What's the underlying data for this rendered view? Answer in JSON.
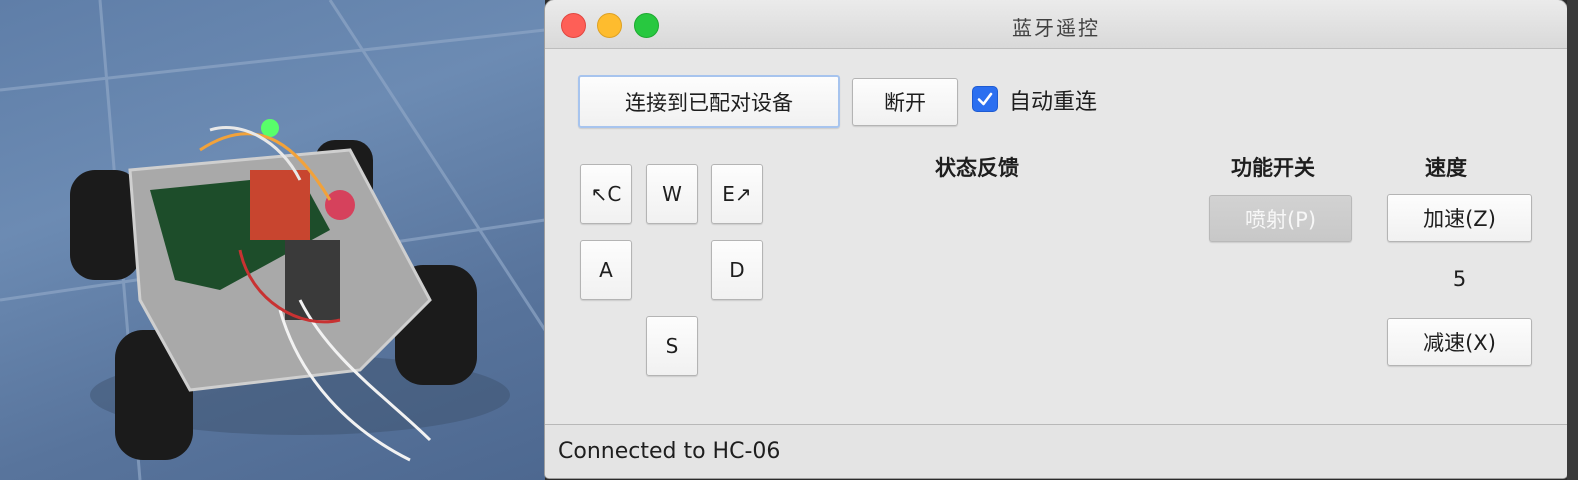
{
  "window": {
    "title": "蓝牙遥控"
  },
  "connection": {
    "connect_label": "连接到已配对设备",
    "disconnect_label": "断开",
    "auto_reconnect_label": "自动重连",
    "auto_reconnect_checked": true
  },
  "keys": {
    "q": "↖C",
    "w": "W",
    "e": "E↗",
    "a": "A",
    "d": "D",
    "s": "S"
  },
  "status_panel": {
    "heading": "状态反馈"
  },
  "function_panel": {
    "heading": "功能开关",
    "spray_label": "喷射(P)",
    "spray_enabled": false
  },
  "speed_panel": {
    "heading": "速度",
    "increase_label": "加速(Z)",
    "value": "5",
    "decrease_label": "减速(X)"
  },
  "statusbar": {
    "text": "Connected to HC-06"
  },
  "colors": {
    "accent": "#2b6ff0",
    "window_bg": "#e7e7e7",
    "close": "#fe5f57",
    "minimize": "#febc2e",
    "maximize": "#28c840"
  }
}
